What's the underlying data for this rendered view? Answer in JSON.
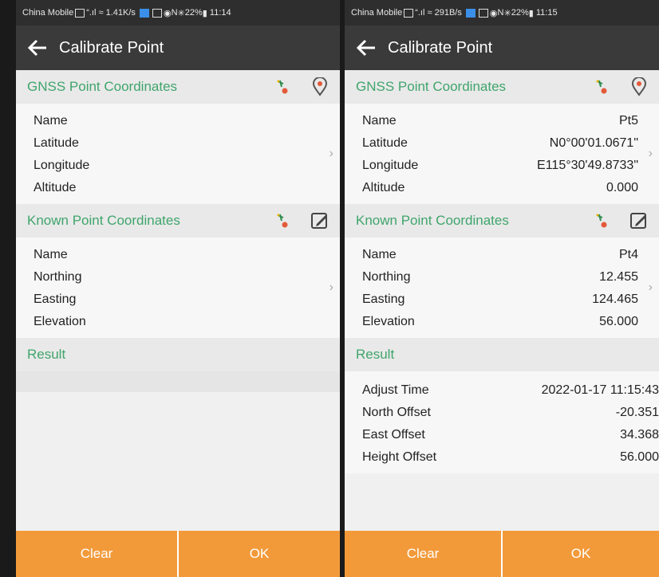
{
  "left": {
    "status": {
      "carrier": "China Mobile",
      "speed": "1.41K/s",
      "battery": "22%",
      "time": "11:14"
    },
    "appbar": {
      "title": "Calibrate Point"
    },
    "gnss": {
      "header": "GNSS Point Coordinates",
      "labels": [
        "Name",
        "Latitude",
        "Longitude",
        "Altitude"
      ],
      "values": [
        "",
        "",
        "",
        ""
      ]
    },
    "known": {
      "header": "Known Point Coordinates",
      "labels": [
        "Name",
        "Northing",
        "Easting",
        "Elevation"
      ],
      "values": [
        "",
        "",
        "",
        ""
      ]
    },
    "result": {
      "header": "Result"
    },
    "buttons": {
      "clear": "Clear",
      "ok": "OK"
    }
  },
  "right": {
    "status": {
      "carrier": "China Mobile",
      "speed": "291B/s",
      "battery": "22%",
      "time": "11:15"
    },
    "appbar": {
      "title": "Calibrate Point"
    },
    "gnss": {
      "header": "GNSS Point Coordinates",
      "labels": [
        "Name",
        "Latitude",
        "Longitude",
        "Altitude"
      ],
      "values": [
        "Pt5",
        "N0°00'01.0671\"",
        "E115°30'49.8733\"",
        "0.000"
      ]
    },
    "known": {
      "header": "Known Point Coordinates",
      "labels": [
        "Name",
        "Northing",
        "Easting",
        "Elevation"
      ],
      "values": [
        "Pt4",
        "12.455",
        "124.465",
        "56.000"
      ]
    },
    "result": {
      "header": "Result",
      "labels": [
        "Adjust Time",
        "North Offset",
        "East Offset",
        "Height Offset"
      ],
      "values": [
        "2022-01-17 11:15:43",
        "-20.351",
        "34.368",
        "56.000"
      ]
    },
    "buttons": {
      "clear": "Clear",
      "ok": "OK"
    }
  },
  "icons": {
    "gnss_pick": "stakeout-point-icon",
    "gnss_map": "location-pin-icon",
    "known_pick": "stakeout-point-icon",
    "known_edit": "edit-icon"
  },
  "colors": {
    "accent": "#3fa56c",
    "button": "#f29a3a",
    "appbar": "#3a3a3a"
  }
}
